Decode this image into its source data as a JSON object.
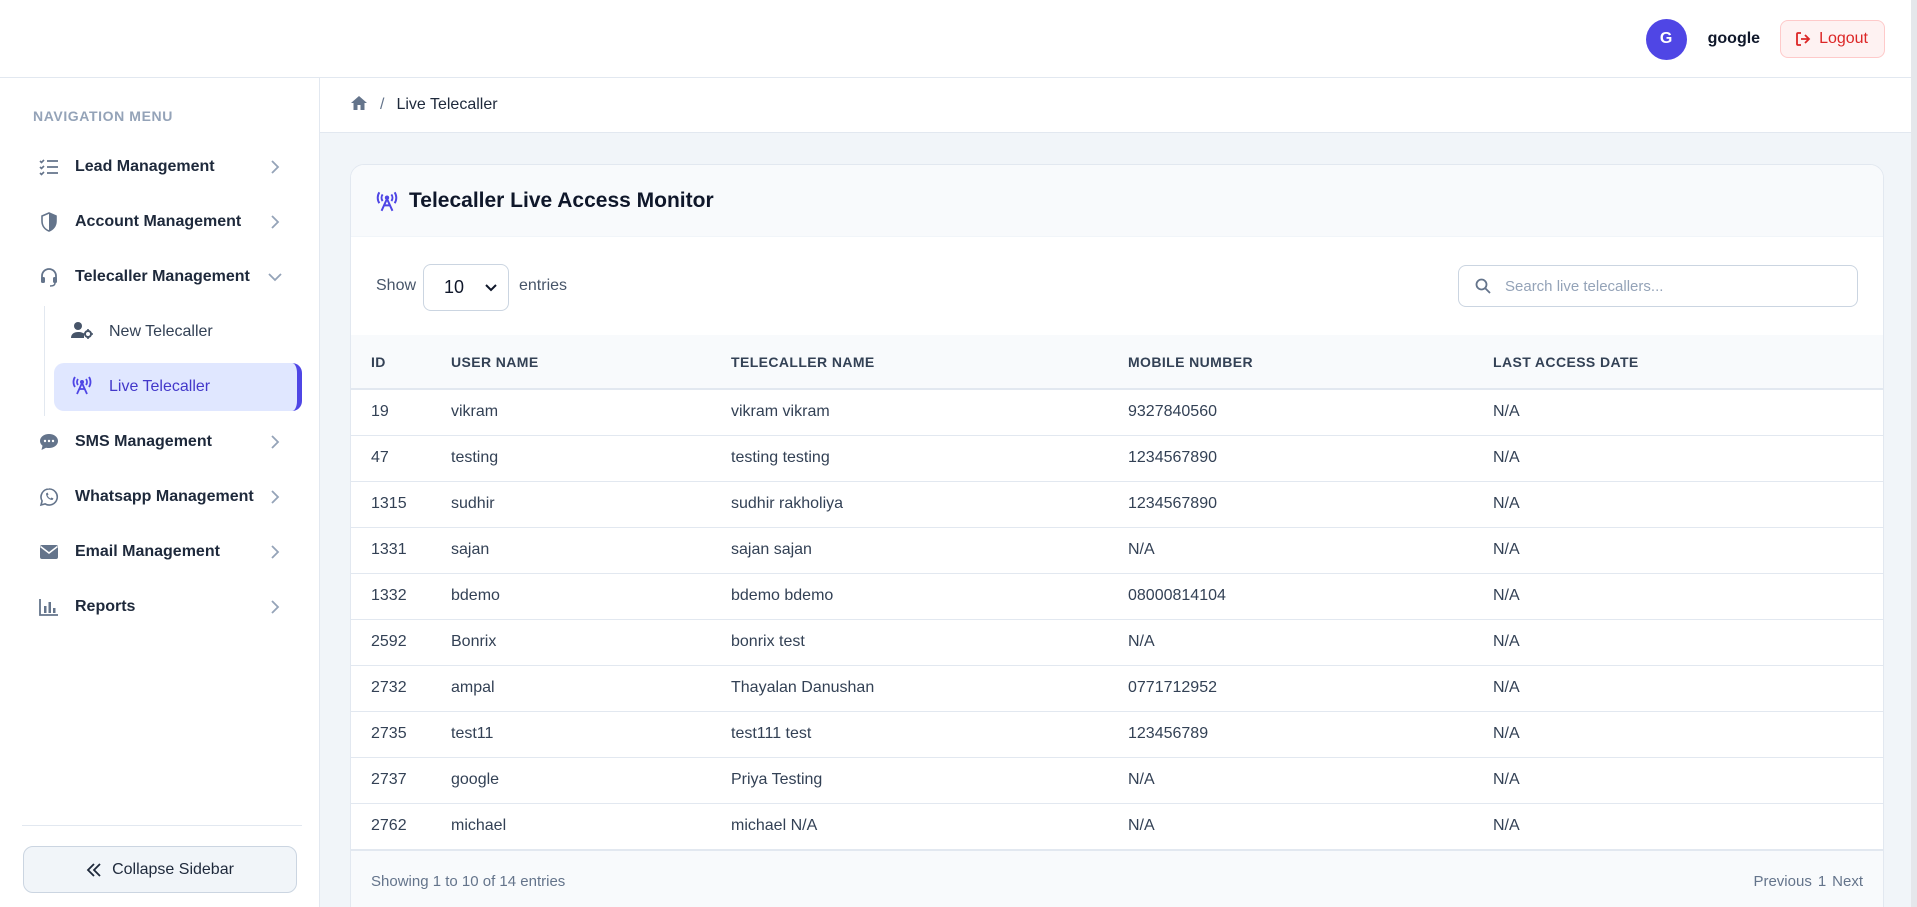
{
  "header": {
    "avatar_initial": "G",
    "username": "google",
    "logout_label": "Logout"
  },
  "sidebar": {
    "heading": "NAVIGATION MENU",
    "items": [
      {
        "label": "Lead Management",
        "icon": "list-check-icon"
      },
      {
        "label": "Account Management",
        "icon": "shield-icon"
      },
      {
        "label": "Telecaller Management",
        "icon": "headset-icon"
      },
      {
        "label": "SMS Management",
        "icon": "sms-bubble-icon"
      },
      {
        "label": "Whatsapp Management",
        "icon": "whatsapp-icon"
      },
      {
        "label": "Email Management",
        "icon": "envelope-icon"
      },
      {
        "label": "Reports",
        "icon": "bar-chart-icon"
      }
    ],
    "sub_items": [
      {
        "label": "New Telecaller",
        "icon": "user-gear-icon"
      },
      {
        "label": "Live Telecaller",
        "icon": "broadcast-tower-icon"
      }
    ],
    "collapse_label": "Collapse Sidebar"
  },
  "breadcrumb": {
    "separator": "/",
    "current": "Live Telecaller"
  },
  "card": {
    "title": "Telecaller Live Access Monitor",
    "show_label": "Show",
    "entries_value": "10",
    "entries_label": "entries",
    "search_placeholder": "Search live telecallers..."
  },
  "table": {
    "columns": [
      "ID",
      "USER NAME",
      "TELECALLER NAME",
      "MOBILE NUMBER",
      "LAST ACCESS DATE"
    ],
    "rows": [
      [
        "19",
        "vikram",
        "vikram vikram",
        "9327840560",
        "N/A"
      ],
      [
        "47",
        "testing",
        "testing testing",
        "1234567890",
        "N/A"
      ],
      [
        "1315",
        "sudhir",
        "sudhir rakholiya",
        "1234567890",
        "N/A"
      ],
      [
        "1331",
        "sajan",
        "sajan sajan",
        "N/A",
        "N/A"
      ],
      [
        "1332",
        "bdemo",
        "bdemo bdemo",
        "08000814104",
        "N/A"
      ],
      [
        "2592",
        "Bonrix",
        "bonrix test",
        "N/A",
        "N/A"
      ],
      [
        "2732",
        "ampal",
        "Thayalan Danushan",
        "0771712952",
        "N/A"
      ],
      [
        "2735",
        "test11",
        "test111 test",
        "123456789",
        "N/A"
      ],
      [
        "2737",
        "google",
        "Priya Testing",
        "N/A",
        "N/A"
      ],
      [
        "2762",
        "michael",
        "michael N/A",
        "N/A",
        "N/A"
      ]
    ]
  },
  "footer": {
    "info": "Showing 1 to 10 of 14 entries",
    "previous": "Previous",
    "page": "1",
    "next": "Next"
  },
  "colors": {
    "accent": "#4f46e5",
    "logout": "#dc2626"
  }
}
